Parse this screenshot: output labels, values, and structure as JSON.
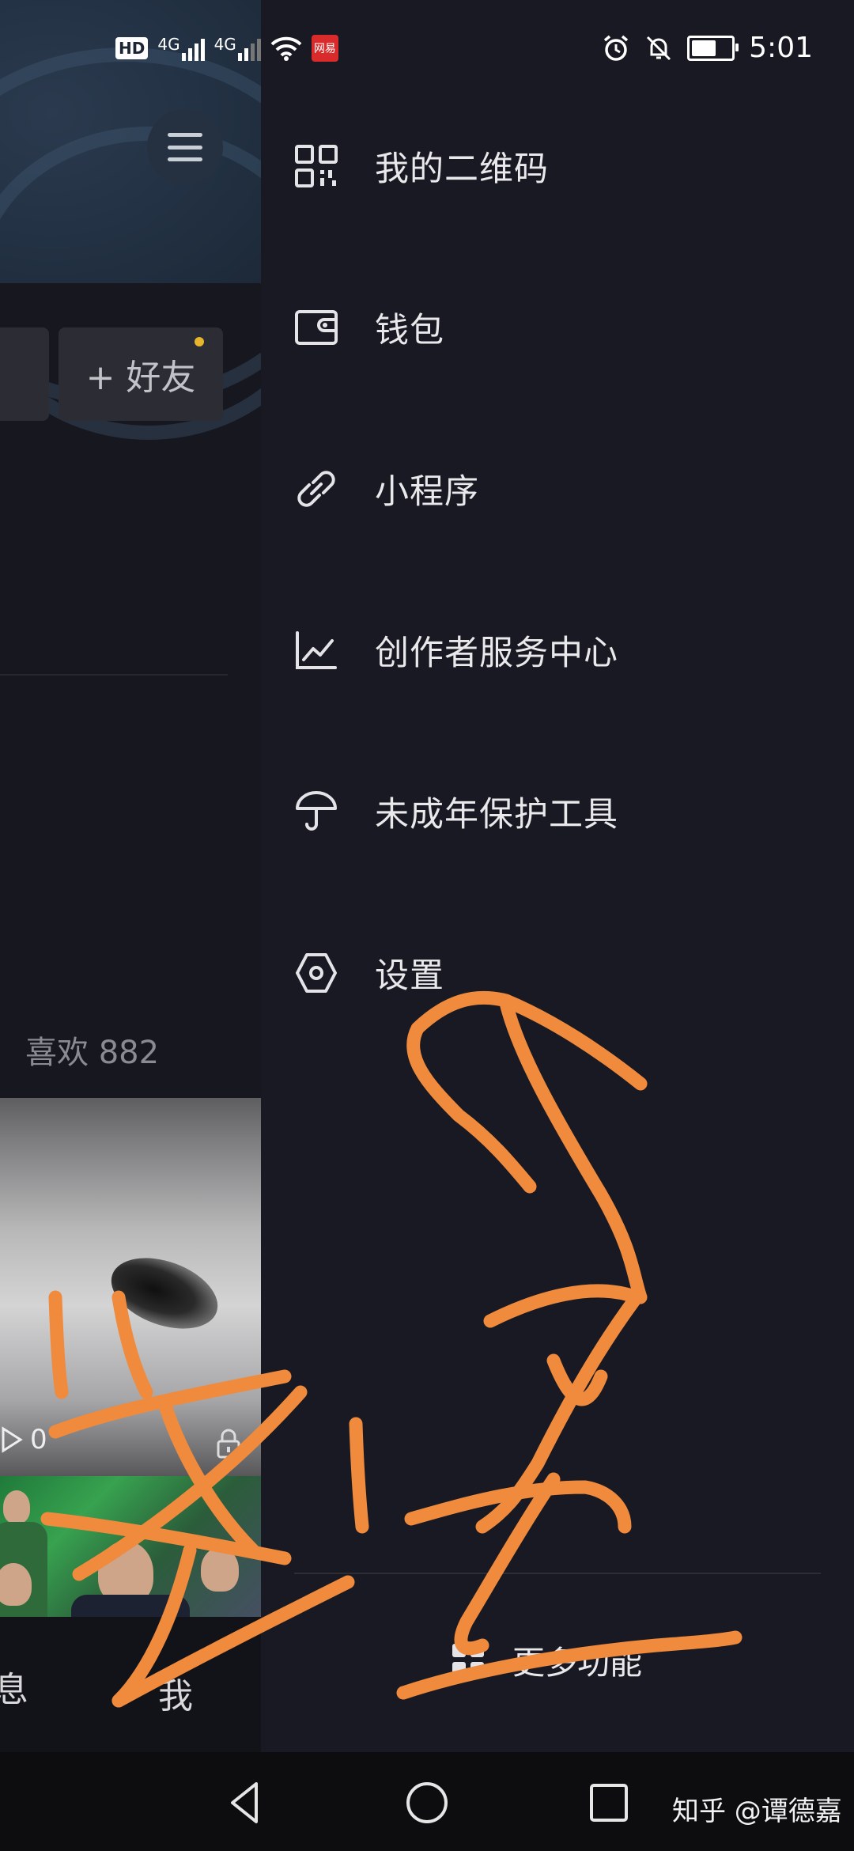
{
  "status_bar": {
    "network_badge": "HD",
    "network_type_1": "4G",
    "network_type_2": "4G",
    "app_badge": "网易",
    "time": "5:01"
  },
  "profile_bg": {
    "add_friend_label": "+ 好友",
    "likes_label": "喜欢 882",
    "thumb_play_count": "0",
    "tab_message_partial": "息",
    "tab_me": "我"
  },
  "drawer": {
    "items": [
      {
        "label": "我的二维码",
        "icon": "qrcode-icon"
      },
      {
        "label": "钱包",
        "icon": "wallet-icon"
      },
      {
        "label": "小程序",
        "icon": "link-icon"
      },
      {
        "label": "创作者服务中心",
        "icon": "chart-icon"
      },
      {
        "label": "未成年保护工具",
        "icon": "umbrella-icon"
      },
      {
        "label": "设置",
        "icon": "hexagon-settings-icon"
      }
    ],
    "more_label": "更多功能"
  },
  "watermark": "知乎 @谭德嘉",
  "colors": {
    "drawer_bg": "#181922",
    "scribble": "#f08a3c",
    "badge_dot": "#e5b52d"
  }
}
